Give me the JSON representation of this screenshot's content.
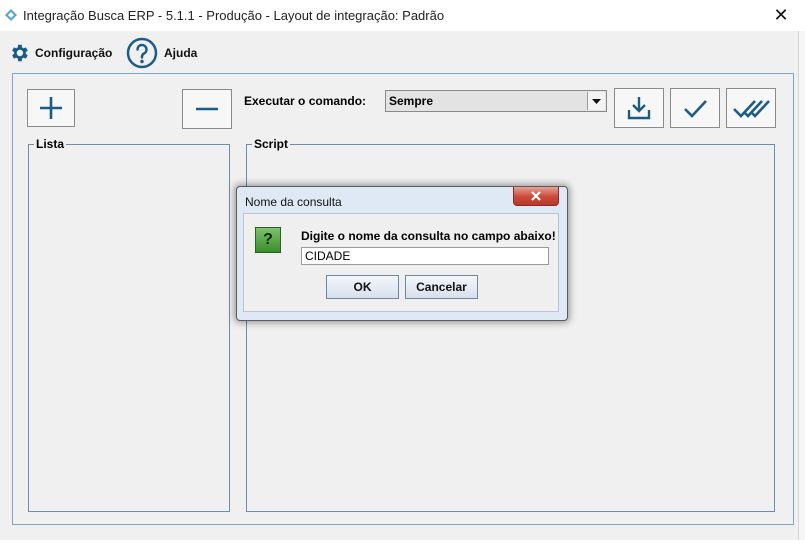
{
  "window": {
    "title": "Integração Busca ERP - 5.1.1 - Produção - Layout de integração: Padrão",
    "close_symbol": "✕"
  },
  "menu": {
    "config_label": "Configuração",
    "help_label": "Ajuda"
  },
  "toolbar": {
    "execute_label": "Executar o comando:",
    "execute_value": "Sempre"
  },
  "panels": {
    "list_title": "Lista",
    "script_title": "Script"
  },
  "dialog": {
    "title": "Nome da consulta",
    "icon_symbol": "?",
    "prompt": "Digite o nome da consulta no campo abaixo!",
    "input_value": "CIDADE",
    "ok_label": "OK",
    "cancel_label": "Cancelar"
  },
  "colors": {
    "accent_icon": "#1a5c86",
    "dialog_frame": "#dfe9f5",
    "close_red": "#c9493a",
    "question_green": "#5aa84a"
  },
  "icons": [
    "app-icon",
    "gear-icon",
    "help-icon",
    "plus-icon",
    "minus-icon",
    "chevron-down-icon",
    "download-icon",
    "check-icon",
    "double-check-icon",
    "close-icon",
    "question-icon"
  ]
}
